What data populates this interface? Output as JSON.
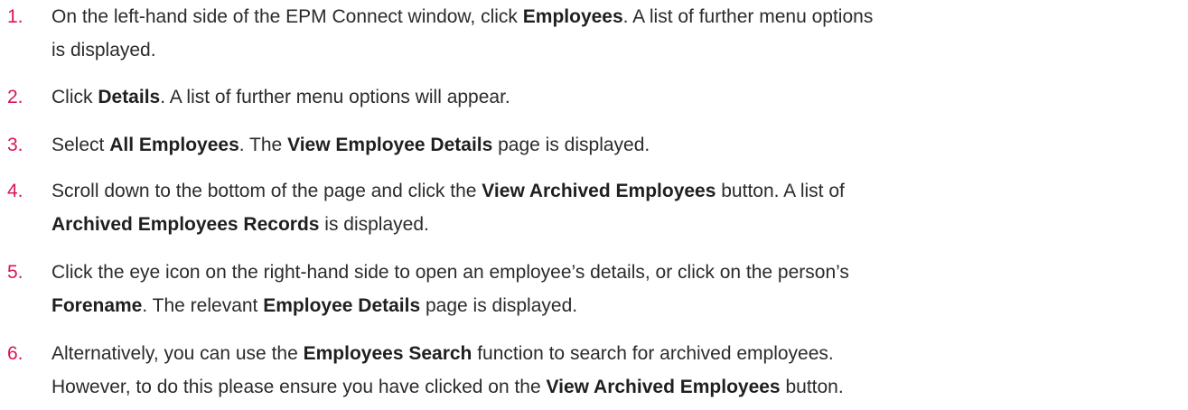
{
  "steps": [
    {
      "number": "1.",
      "segments": [
        {
          "text": "On the left-hand side of the EPM Connect window, click ",
          "bold": false
        },
        {
          "text": "Employees",
          "bold": true
        },
        {
          "text": ". A list of further menu options",
          "bold": false
        },
        {
          "text": "\n",
          "bold": false
        },
        {
          "text": "is displayed.",
          "bold": false
        }
      ]
    },
    {
      "number": "2.",
      "segments": [
        {
          "text": "Click ",
          "bold": false
        },
        {
          "text": "Details",
          "bold": true
        },
        {
          "text": ". A list of further menu options will appear.",
          "bold": false
        }
      ]
    },
    {
      "number": "3.",
      "segments": [
        {
          "text": "Select ",
          "bold": false
        },
        {
          "text": "All Employees",
          "bold": true
        },
        {
          "text": ". The ",
          "bold": false
        },
        {
          "text": "View Employee Details",
          "bold": true
        },
        {
          "text": " page is displayed.",
          "bold": false
        }
      ]
    },
    {
      "number": "4.",
      "segments": [
        {
          "text": "Scroll down to the bottom of the page and click the ",
          "bold": false
        },
        {
          "text": "View Archived Employees",
          "bold": true
        },
        {
          "text": " button. A list of",
          "bold": false
        },
        {
          "text": "\n",
          "bold": false
        },
        {
          "text": "Archived Employees Records",
          "bold": true
        },
        {
          "text": " is displayed.",
          "bold": false
        }
      ]
    },
    {
      "number": "5.",
      "segments": [
        {
          "text": "Click the eye icon on the right-hand side to open an employee’s details, or click on the person’s",
          "bold": false
        },
        {
          "text": "\n",
          "bold": false
        },
        {
          "text": "Forename",
          "bold": true
        },
        {
          "text": ". The relevant ",
          "bold": false
        },
        {
          "text": "Employee Details",
          "bold": true
        },
        {
          "text": " page is displayed.",
          "bold": false
        }
      ]
    },
    {
      "number": "6.",
      "segments": [
        {
          "text": "Alternatively, you can use the ",
          "bold": false
        },
        {
          "text": "Employees Search",
          "bold": true
        },
        {
          "text": " function to search for archived employees.",
          "bold": false
        },
        {
          "text": "\n",
          "bold": false
        },
        {
          "text": "However, to do this please ensure you have clicked on the ",
          "bold": false
        },
        {
          "text": "View Archived Employees",
          "bold": true
        },
        {
          "text": " button.",
          "bold": false
        }
      ]
    }
  ],
  "colors": {
    "number": "#d9145f",
    "text": "#2b2b2b"
  }
}
